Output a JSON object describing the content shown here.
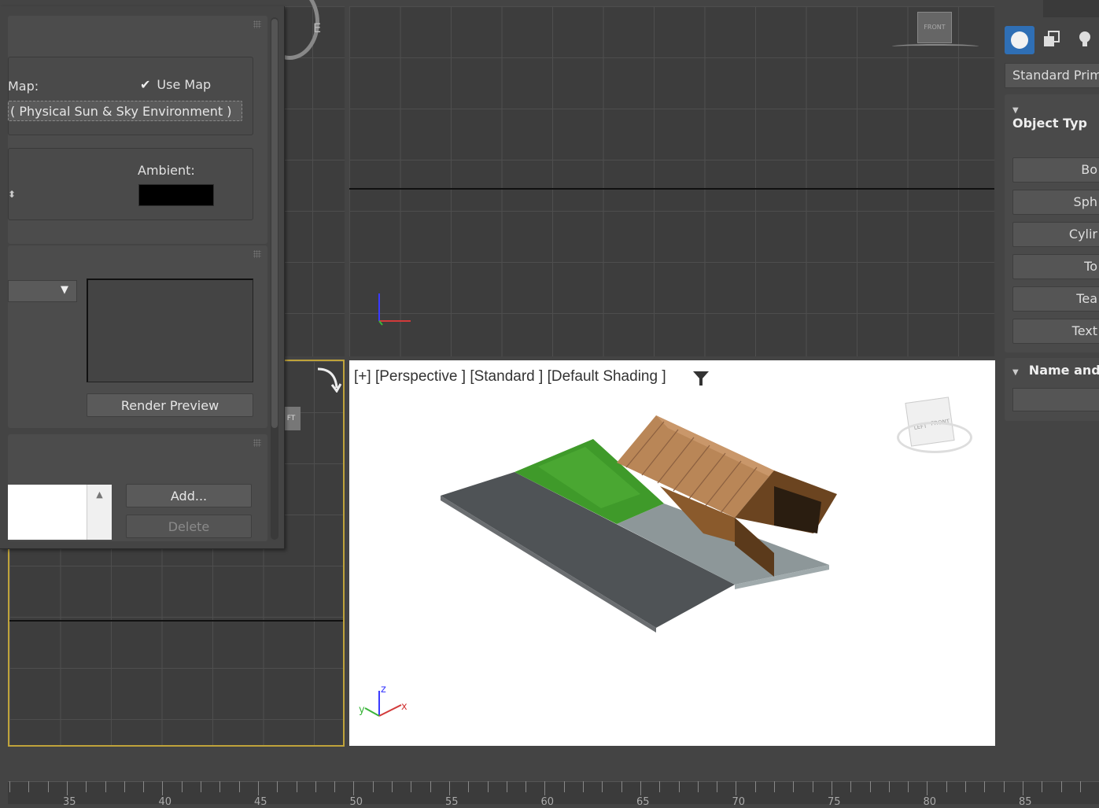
{
  "environment_dialog": {
    "map_label": "Map:",
    "use_map_label": "Use Map",
    "use_map_checked": true,
    "map_name": "( Physical Sun & Sky Environment )",
    "ambient_label": "Ambient:",
    "ambient_color": "#000000",
    "render_preview_label": "Render Preview",
    "add_label": "Add...",
    "delete_label": "Delete"
  },
  "viewports": {
    "top_right": {
      "viewcube_label": "FRONT"
    },
    "perspective": {
      "label_plus": "[+]",
      "label_view": "[Perspective ]",
      "label_mode": "[Standard ]",
      "label_shading": "[Default Shading ]",
      "viewcube_left": "LEFT",
      "viewcube_front": "FRONT"
    },
    "left_partial": {
      "compass_letter": "E",
      "viewcube_label": "FT"
    },
    "axis": {
      "x": "x",
      "y": "y",
      "z": "z"
    }
  },
  "command_panel": {
    "category": "Standard Prim",
    "object_type_title": "Object Typ",
    "buttons": [
      "Bo",
      "Sph",
      "Cylir",
      "To",
      "Tea",
      "Text"
    ],
    "name_color_title": "Name and"
  },
  "timeline": {
    "labels": [
      "35",
      "40",
      "45",
      "50",
      "55",
      "60",
      "65",
      "70",
      "75",
      "80",
      "85"
    ]
  },
  "colors": {
    "accent_active": "#bfa33a",
    "perspective_bg": "#ffffff",
    "viewport_bg": "#3d3d3d"
  }
}
